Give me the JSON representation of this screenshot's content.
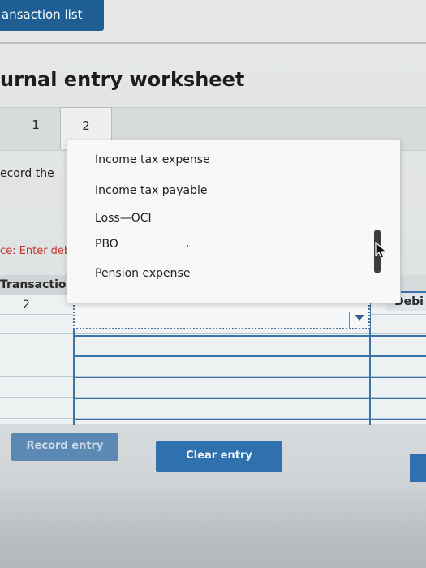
{
  "header": {
    "transaction_list_tab": "ansaction list"
  },
  "page": {
    "title": "urnal entry worksheet"
  },
  "tabs": [
    {
      "label": "1"
    },
    {
      "label": "2"
    }
  ],
  "instruction_text": "ecord the",
  "note_text": "ce: Enter debi",
  "grid": {
    "transaction_header": "Transaction",
    "debit_header": "Debi",
    "rows": [
      {
        "transaction": "2",
        "account": ""
      }
    ]
  },
  "dropdown": {
    "options": [
      "Income tax expense",
      "Income tax payable",
      "Loss—OCI",
      "PBO",
      "Pension expense"
    ]
  },
  "buttons": {
    "record_entry": "Record entry",
    "clear_entry": "Clear entry"
  },
  "colors": {
    "accent": "#2f70ae",
    "tab_dark": "#1f5e93",
    "note_red": "#c2362c"
  }
}
